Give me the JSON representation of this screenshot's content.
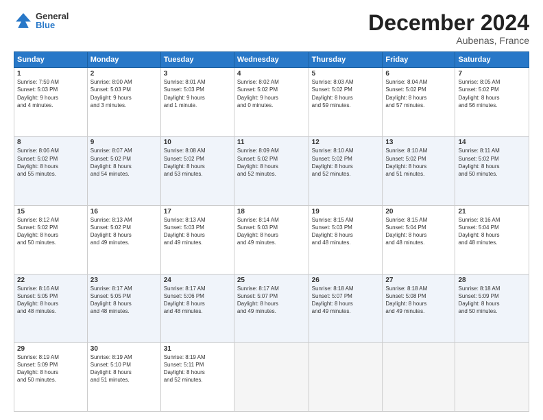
{
  "header": {
    "logo_general": "General",
    "logo_blue": "Blue",
    "month_title": "December 2024",
    "location": "Aubenas, France"
  },
  "weekdays": [
    "Sunday",
    "Monday",
    "Tuesday",
    "Wednesday",
    "Thursday",
    "Friday",
    "Saturday"
  ],
  "weeks": [
    [
      {
        "day": "1",
        "info": "Sunrise: 7:59 AM\nSunset: 5:03 PM\nDaylight: 9 hours\nand 4 minutes."
      },
      {
        "day": "2",
        "info": "Sunrise: 8:00 AM\nSunset: 5:03 PM\nDaylight: 9 hours\nand 3 minutes."
      },
      {
        "day": "3",
        "info": "Sunrise: 8:01 AM\nSunset: 5:03 PM\nDaylight: 9 hours\nand 1 minute."
      },
      {
        "day": "4",
        "info": "Sunrise: 8:02 AM\nSunset: 5:02 PM\nDaylight: 9 hours\nand 0 minutes."
      },
      {
        "day": "5",
        "info": "Sunrise: 8:03 AM\nSunset: 5:02 PM\nDaylight: 8 hours\nand 59 minutes."
      },
      {
        "day": "6",
        "info": "Sunrise: 8:04 AM\nSunset: 5:02 PM\nDaylight: 8 hours\nand 57 minutes."
      },
      {
        "day": "7",
        "info": "Sunrise: 8:05 AM\nSunset: 5:02 PM\nDaylight: 8 hours\nand 56 minutes."
      }
    ],
    [
      {
        "day": "8",
        "info": "Sunrise: 8:06 AM\nSunset: 5:02 PM\nDaylight: 8 hours\nand 55 minutes."
      },
      {
        "day": "9",
        "info": "Sunrise: 8:07 AM\nSunset: 5:02 PM\nDaylight: 8 hours\nand 54 minutes."
      },
      {
        "day": "10",
        "info": "Sunrise: 8:08 AM\nSunset: 5:02 PM\nDaylight: 8 hours\nand 53 minutes."
      },
      {
        "day": "11",
        "info": "Sunrise: 8:09 AM\nSunset: 5:02 PM\nDaylight: 8 hours\nand 52 minutes."
      },
      {
        "day": "12",
        "info": "Sunrise: 8:10 AM\nSunset: 5:02 PM\nDaylight: 8 hours\nand 52 minutes."
      },
      {
        "day": "13",
        "info": "Sunrise: 8:10 AM\nSunset: 5:02 PM\nDaylight: 8 hours\nand 51 minutes."
      },
      {
        "day": "14",
        "info": "Sunrise: 8:11 AM\nSunset: 5:02 PM\nDaylight: 8 hours\nand 50 minutes."
      }
    ],
    [
      {
        "day": "15",
        "info": "Sunrise: 8:12 AM\nSunset: 5:02 PM\nDaylight: 8 hours\nand 50 minutes."
      },
      {
        "day": "16",
        "info": "Sunrise: 8:13 AM\nSunset: 5:02 PM\nDaylight: 8 hours\nand 49 minutes."
      },
      {
        "day": "17",
        "info": "Sunrise: 8:13 AM\nSunset: 5:03 PM\nDaylight: 8 hours\nand 49 minutes."
      },
      {
        "day": "18",
        "info": "Sunrise: 8:14 AM\nSunset: 5:03 PM\nDaylight: 8 hours\nand 49 minutes."
      },
      {
        "day": "19",
        "info": "Sunrise: 8:15 AM\nSunset: 5:03 PM\nDaylight: 8 hours\nand 48 minutes."
      },
      {
        "day": "20",
        "info": "Sunrise: 8:15 AM\nSunset: 5:04 PM\nDaylight: 8 hours\nand 48 minutes."
      },
      {
        "day": "21",
        "info": "Sunrise: 8:16 AM\nSunset: 5:04 PM\nDaylight: 8 hours\nand 48 minutes."
      }
    ],
    [
      {
        "day": "22",
        "info": "Sunrise: 8:16 AM\nSunset: 5:05 PM\nDaylight: 8 hours\nand 48 minutes."
      },
      {
        "day": "23",
        "info": "Sunrise: 8:17 AM\nSunset: 5:05 PM\nDaylight: 8 hours\nand 48 minutes."
      },
      {
        "day": "24",
        "info": "Sunrise: 8:17 AM\nSunset: 5:06 PM\nDaylight: 8 hours\nand 48 minutes."
      },
      {
        "day": "25",
        "info": "Sunrise: 8:17 AM\nSunset: 5:07 PM\nDaylight: 8 hours\nand 49 minutes."
      },
      {
        "day": "26",
        "info": "Sunrise: 8:18 AM\nSunset: 5:07 PM\nDaylight: 8 hours\nand 49 minutes."
      },
      {
        "day": "27",
        "info": "Sunrise: 8:18 AM\nSunset: 5:08 PM\nDaylight: 8 hours\nand 49 minutes."
      },
      {
        "day": "28",
        "info": "Sunrise: 8:18 AM\nSunset: 5:09 PM\nDaylight: 8 hours\nand 50 minutes."
      }
    ],
    [
      {
        "day": "29",
        "info": "Sunrise: 8:19 AM\nSunset: 5:09 PM\nDaylight: 8 hours\nand 50 minutes."
      },
      {
        "day": "30",
        "info": "Sunrise: 8:19 AM\nSunset: 5:10 PM\nDaylight: 8 hours\nand 51 minutes."
      },
      {
        "day": "31",
        "info": "Sunrise: 8:19 AM\nSunset: 5:11 PM\nDaylight: 8 hours\nand 52 minutes."
      },
      {
        "day": "",
        "info": ""
      },
      {
        "day": "",
        "info": ""
      },
      {
        "day": "",
        "info": ""
      },
      {
        "day": "",
        "info": ""
      }
    ]
  ]
}
